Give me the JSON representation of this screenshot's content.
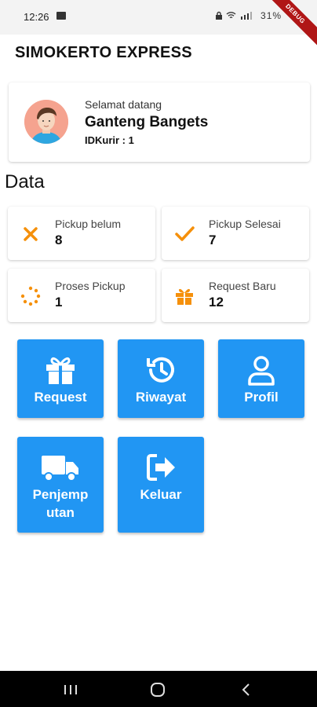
{
  "status_bar": {
    "time": "12:26",
    "battery": "31%"
  },
  "debug_label": "DEBUG",
  "app": {
    "title": "SIMOKERTO EXPRESS"
  },
  "profile": {
    "greeting": "Selamat datang",
    "name": "Ganteng Bangets",
    "id_text": "IDKurir : 1"
  },
  "section_title": "Data",
  "stats": [
    {
      "label": "Pickup belum",
      "value": "8",
      "icon": "close-icon"
    },
    {
      "label": "Pickup Selesai",
      "value": "7",
      "icon": "check-icon"
    },
    {
      "label": "Proses Pickup",
      "value": "1",
      "icon": "spinner-icon"
    },
    {
      "label": "Request Baru",
      "value": "12",
      "icon": "gift-icon"
    }
  ],
  "menu": [
    {
      "label": "Request",
      "icon": "gift-icon"
    },
    {
      "label": "Riwayat",
      "icon": "history-icon"
    },
    {
      "label": "Profil",
      "icon": "person-icon"
    },
    {
      "label_line1": "Penjemp",
      "label_line2": "utan",
      "icon": "truck-icon"
    },
    {
      "label": "Keluar",
      "icon": "logout-icon"
    }
  ],
  "colors": {
    "primary": "#2196f3",
    "accent": "#f5900b",
    "debug": "#b01616"
  }
}
